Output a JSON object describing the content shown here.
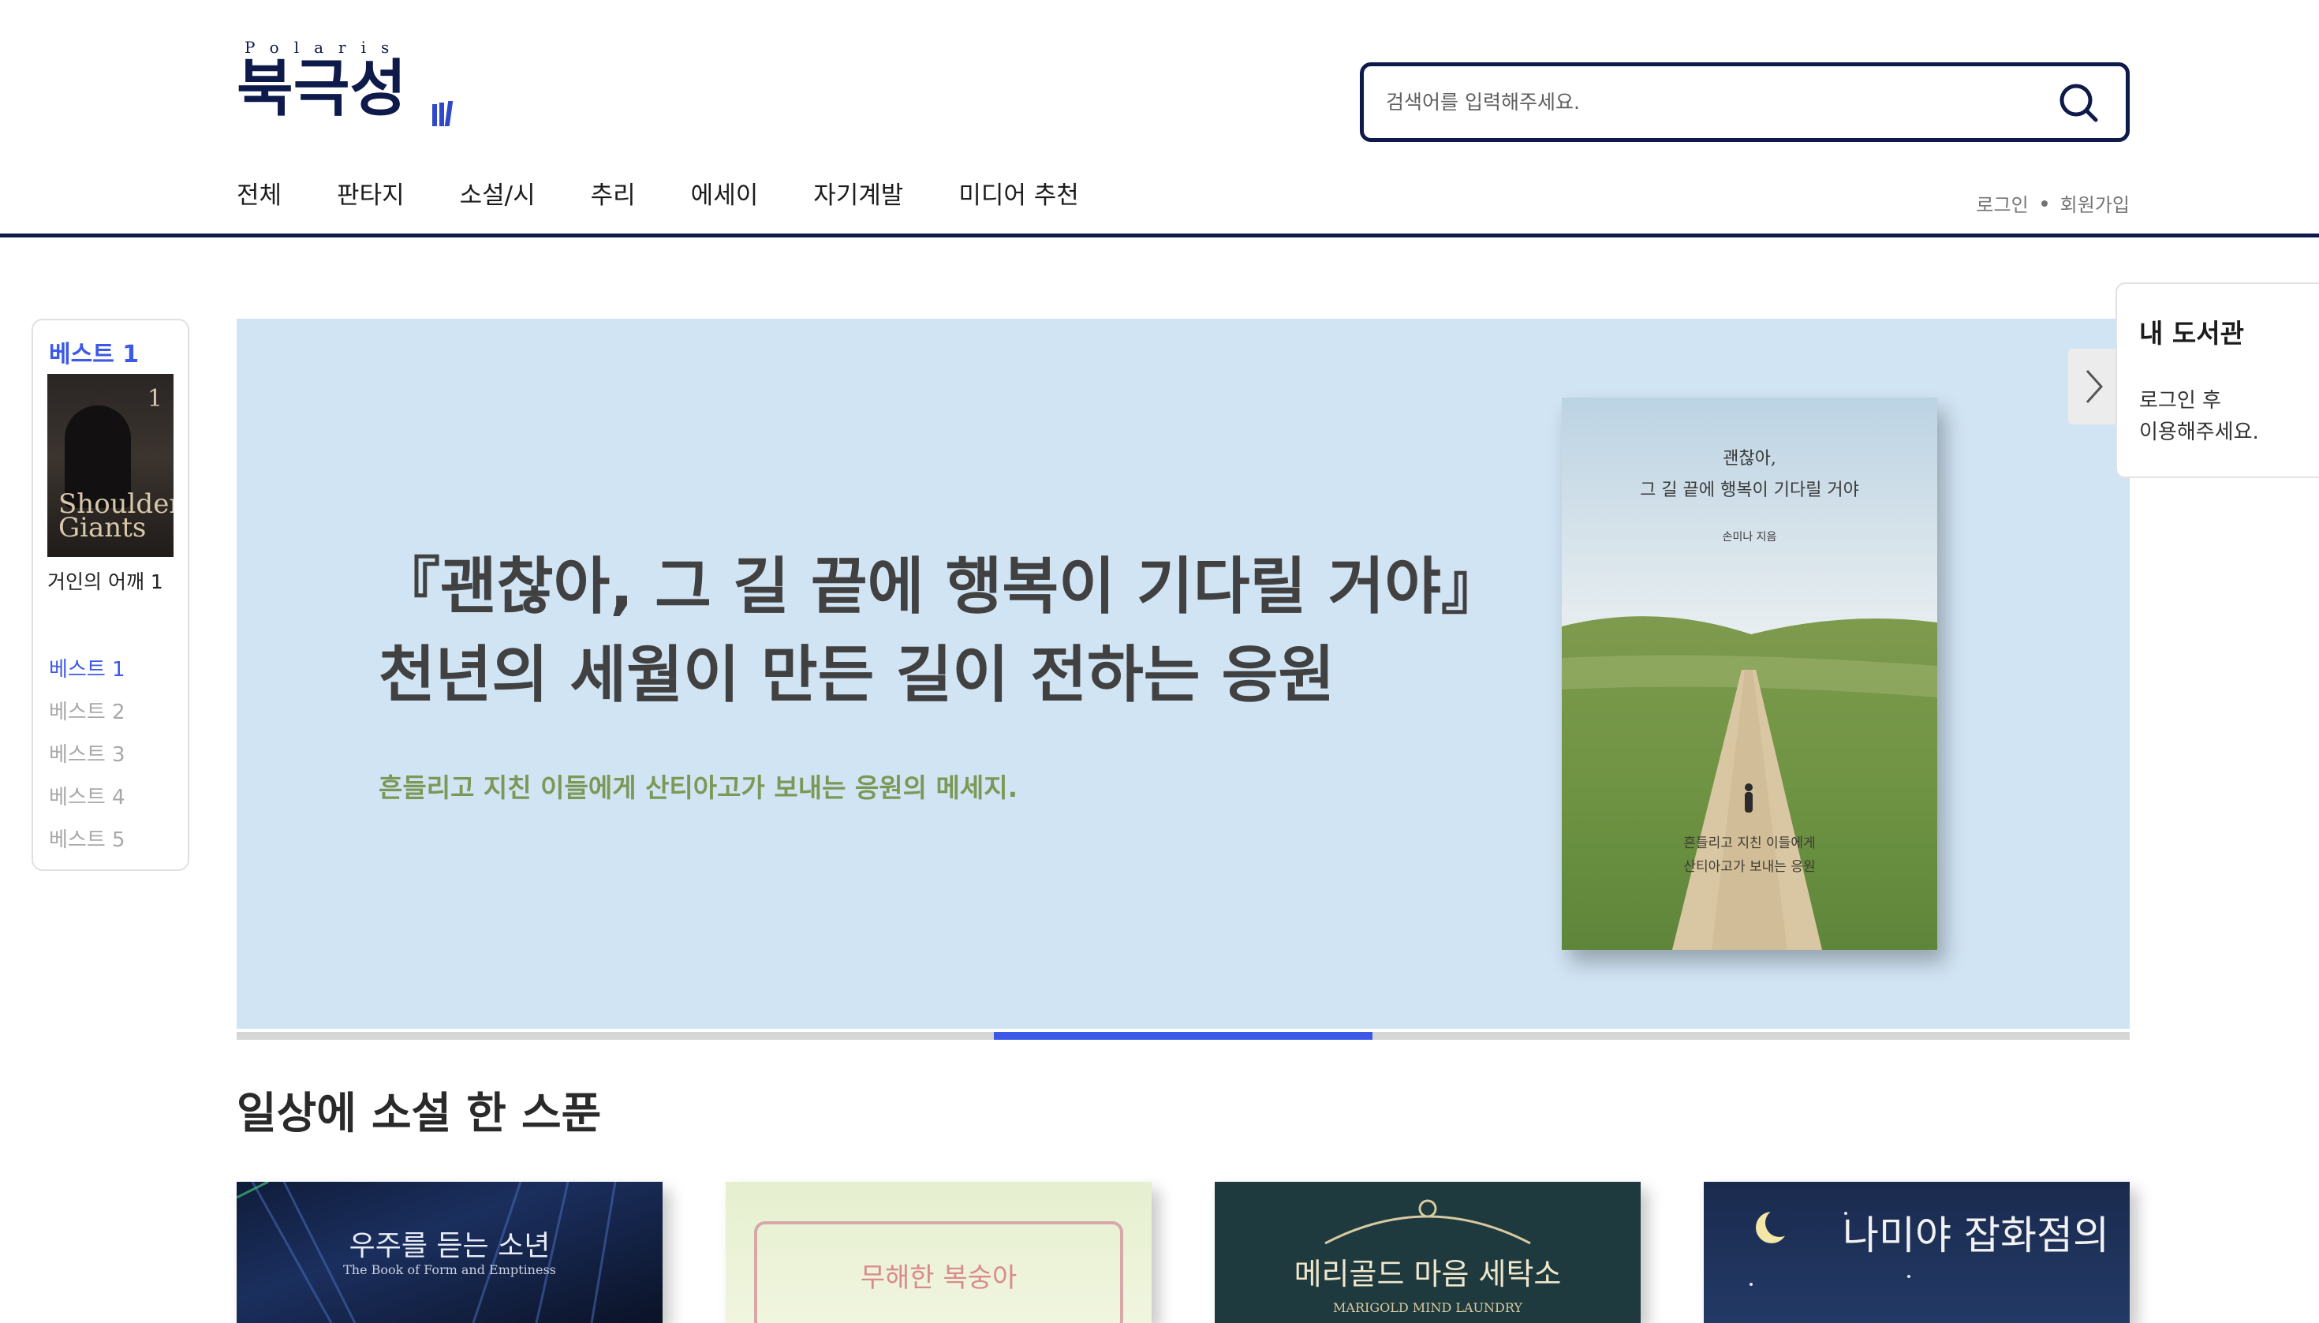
{
  "brand": {
    "latin": "Polaris",
    "name": "북극성"
  },
  "search": {
    "placeholder": "검색어를 입력해주세요."
  },
  "nav": {
    "items": [
      "전체",
      "판타지",
      "소설/시",
      "추리",
      "에세이",
      "자기계발",
      "미디어 추천"
    ]
  },
  "auth": {
    "login": "로그인",
    "signup": "회원가입"
  },
  "best_panel": {
    "heading": "베스트 1",
    "cover": {
      "volume": "1",
      "title_text": "Shoulders Giants"
    },
    "book_title": "거인의 어깨 1",
    "items": [
      "베스트 1",
      "베스트 2",
      "베스트 3",
      "베스트 4",
      "베스트 5"
    ],
    "active_index": 0
  },
  "hero": {
    "title_line1": "『괜찮아, 그 길 끝에 행복이 기다릴 거야』",
    "title_line2": "천년의 세월이 만든 길이 전하는 응원",
    "subtitle": "흔들리고 지친 이들에게 산티아고가 보내는 응원의 메세지.",
    "book": {
      "title_line1": "괜찮아,",
      "title_line2": "그 길 끝에 행복이 기다릴 거야",
      "author": "손미나 지음",
      "tagline_line1": "흔들리고 지친 이들에게",
      "tagline_line2": "산티아고가 보내는 응원"
    },
    "background_color": "#d1e4f4",
    "subtitle_color": "#7b9856"
  },
  "carousel": {
    "slide_count": 5,
    "current_slide": 3
  },
  "library": {
    "title": "내 도서관",
    "message_line1": "로그인 후",
    "message_line2": "이용해주세요."
  },
  "section": {
    "title": "일상에 소설 한 스푼",
    "books": [
      {
        "title": "우주를 듣는 소년",
        "subtitle": "The Book of Form and Emptiness"
      },
      {
        "title": "무해한 복숭아",
        "subtitle": ""
      },
      {
        "title": "메리골드 마음 세탁소",
        "subtitle": "MARIGOLD MIND LAUNDRY"
      },
      {
        "title": "나미야 잡화점의",
        "subtitle": ""
      }
    ]
  },
  "colors": {
    "brand_navy": "#0d1a4a",
    "accent_blue": "#3c58e6"
  },
  "icons": {
    "search": "search-icon",
    "next": "chevron-right-icon",
    "logo_mark": "books-icon"
  }
}
